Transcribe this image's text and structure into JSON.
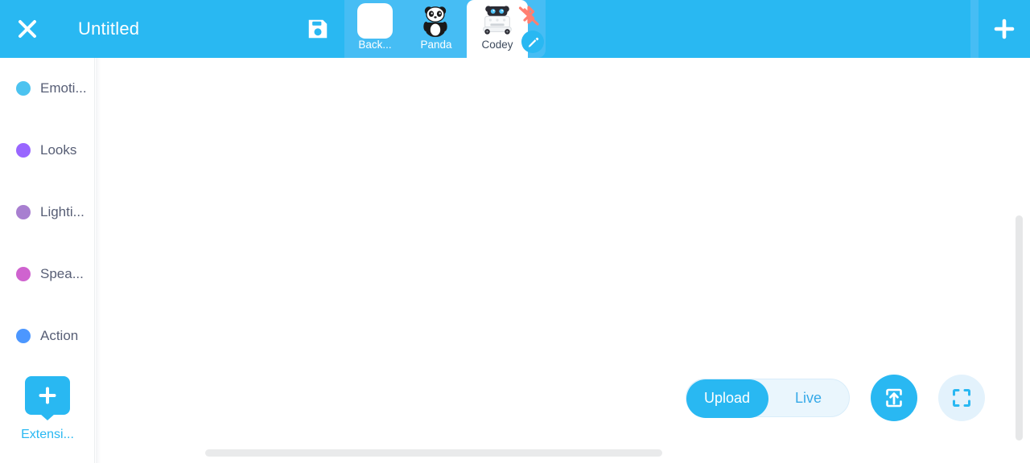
{
  "header": {
    "close_icon": "close-icon",
    "project_title": "Untitled",
    "save_icon": "save-floppy-icon",
    "add_sprite_icon": "plus-icon",
    "sprites": [
      {
        "label": "Back...",
        "icon": "backdrop-thumbnail",
        "active": false
      },
      {
        "label": "Panda",
        "icon": "panda-sprite-thumbnail",
        "active": false
      },
      {
        "label": "Codey",
        "icon": "codey-robot-thumbnail",
        "active": true,
        "bluetooth_status_icon": "bluetooth-disconnected-icon",
        "edit_icon": "pencil-edit-icon"
      }
    ]
  },
  "sidebar": {
    "categories": [
      {
        "label": "Emoti...",
        "full_label": "Emotion",
        "color": "#4CC3F0"
      },
      {
        "label": "Looks",
        "full_label": "Looks",
        "color": "#9966FF"
      },
      {
        "label": "Lighti...",
        "full_label": "Lighting",
        "color": "#A87FD0"
      },
      {
        "label": "Spea...",
        "full_label": "Speaker",
        "color": "#CF63CF"
      },
      {
        "label": "Action",
        "full_label": "Action",
        "color": "#4C97FF"
      }
    ],
    "extension": {
      "label": "Extensi...",
      "full_label": "Extensions",
      "icon": "plus-icon",
      "color": "#29b8f2"
    }
  },
  "canvas": {
    "vertical_scrollbar": "vertical-scrollbar",
    "horizontal_scrollbar": "horizontal-scrollbar"
  },
  "controls": {
    "mode_toggle": {
      "options": [
        "Upload",
        "Live"
      ],
      "selected": "Upload"
    },
    "upload_button_icon": "upload-to-device-icon",
    "fullscreen_button_icon": "fullscreen-expand-icon"
  },
  "colors": {
    "header_blue": "#29b8f2",
    "strip_blue": "#46bdf4",
    "accent": "#29b8f2",
    "text_gray": "#575e75",
    "bluetooth_off": "#ff7f71"
  }
}
